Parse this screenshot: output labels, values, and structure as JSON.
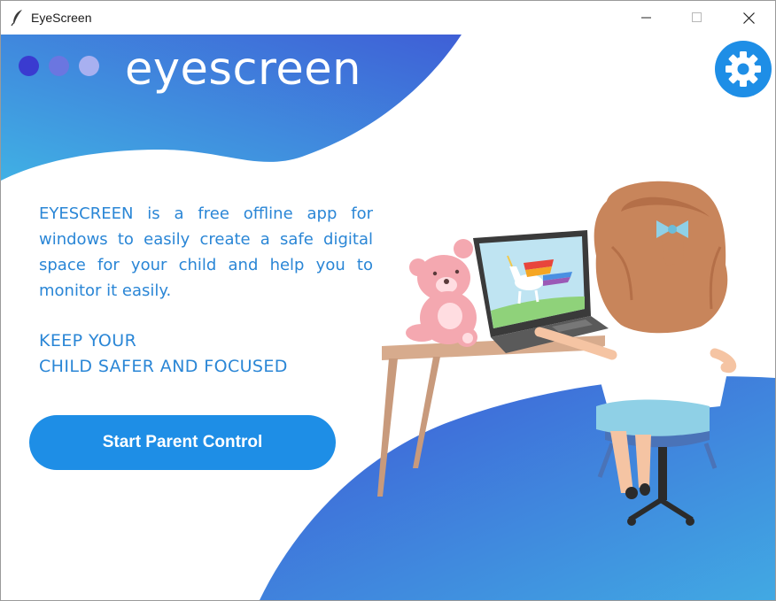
{
  "window": {
    "title": "EyeScreen",
    "controls": [
      "minimize",
      "maximize",
      "close"
    ]
  },
  "header": {
    "brand": "eyescreen",
    "dot_colors": [
      "#3a3bd0",
      "#6b76e0",
      "#a8b0f0"
    ],
    "settings_icon": "gear-icon"
  },
  "main": {
    "description_lines": [
      "EYESCREEN is a free offline app for",
      "windows to easily create a safe digital",
      "space for your child and help you to",
      "monitor it easily."
    ],
    "tagline_lines": [
      "KEEP YOUR",
      "CHILD SAFER AND FOCUSED"
    ],
    "cta_label": "Start Parent Control"
  },
  "colors": {
    "accent": "#1e8ee6",
    "text_blue": "#2a86d6",
    "wave_top": "#3fa8e2",
    "wave_bottom": "#3f63d8"
  }
}
